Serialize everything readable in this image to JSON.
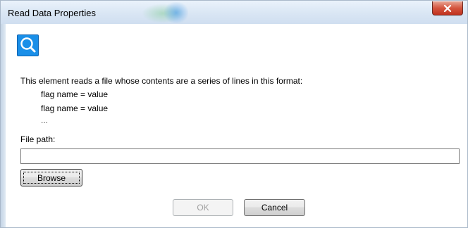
{
  "window": {
    "title": "Read Data Properties",
    "close_label": "x"
  },
  "description": {
    "intro": "This element reads a file whose contents are a series of lines in this format:",
    "example_lines": [
      "flag name = value",
      "flag name = value"
    ],
    "ellipsis": "..."
  },
  "file_path": {
    "label": "File path:",
    "value": "",
    "placeholder": ""
  },
  "buttons": {
    "browse": "Browse",
    "ok": "OK",
    "cancel": "Cancel"
  },
  "icons": {
    "app": "magnifier-icon",
    "close": "close-icon"
  },
  "colors": {
    "app_icon": "#1a8fe8",
    "close_button": "#c8432d"
  }
}
